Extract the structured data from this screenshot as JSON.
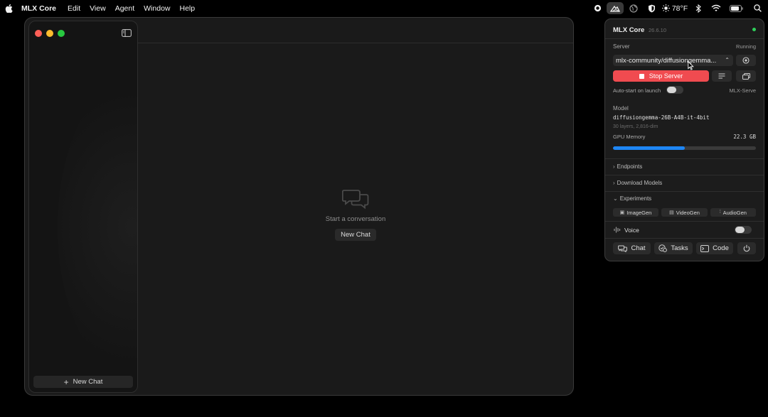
{
  "menubar": {
    "apple_icon": "apple-icon",
    "app_name": "MLX Core",
    "menus": [
      "Edit",
      "View",
      "Agent",
      "Window",
      "Help"
    ],
    "weather": "78°F"
  },
  "window": {
    "sidebar": {
      "new_chat_label": "New Chat"
    },
    "empty_state": {
      "message": "Start a conversation",
      "button_label": "New Chat"
    }
  },
  "panel": {
    "title": "MLX Core",
    "version": "26.6.10",
    "server_label": "Server",
    "server_status": "Running",
    "model_select_value": "mlx-community/diffusiongemma...",
    "stop_button_label": "Stop Server",
    "autostart_label": "Auto-start on launch",
    "backend_label": "MLX-Serve",
    "model_label": "Model",
    "model_name": "diffusiongemma-26B-A4B-it-4bit",
    "model_details": "30 layers, 2,816-dim",
    "gpu_memory_label": "GPU Memory",
    "gpu_memory_value": "22.3 GB",
    "gpu_memory_fraction": 0.5,
    "sections": {
      "endpoints": "Endpoints",
      "download_models": "Download Models",
      "experiments": "Experiments"
    },
    "experiment_buttons": {
      "image_gen": "ImageGen",
      "video_gen": "VideoGen",
      "audio_gen": "AudioGen"
    },
    "voice_label": "Voice",
    "bottom_buttons": {
      "chat": "Chat",
      "tasks": "Tasks",
      "code": "Code"
    },
    "colors": {
      "status_running": "#2fd05b",
      "stop_button": "#f04b50",
      "gpu_bar": "#1e86f4"
    }
  }
}
